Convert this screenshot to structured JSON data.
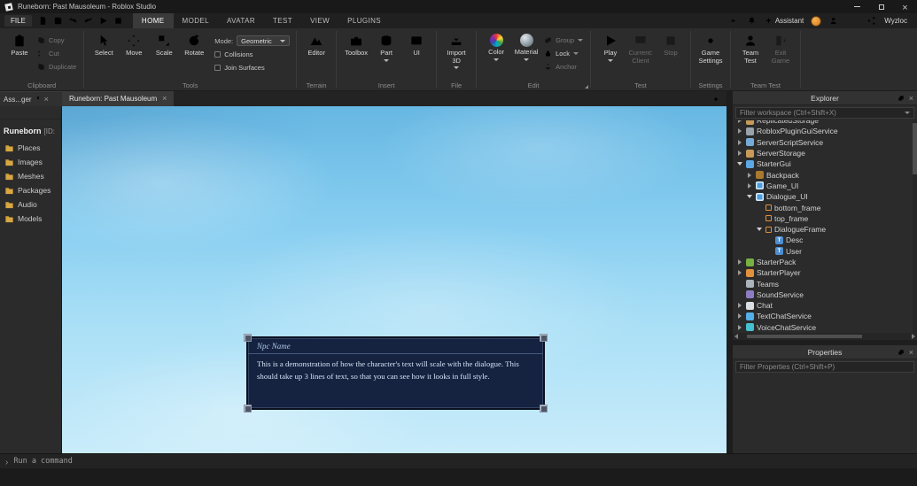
{
  "window": {
    "title": "Runeborn: Past Mausoleum - Roblox Studio"
  },
  "menubar": {
    "file_label": "FILE",
    "tabs": [
      {
        "label": "HOME",
        "state": "active"
      },
      {
        "label": "MODEL",
        "state": ""
      },
      {
        "label": "AVATAR",
        "state": ""
      },
      {
        "label": "TEST",
        "state": ""
      },
      {
        "label": "VIEW",
        "state": ""
      },
      {
        "label": "PLUGINS",
        "state": ""
      }
    ],
    "assistant_label": "Assistant",
    "username": "Wyzloc"
  },
  "ribbon": {
    "clipboard": {
      "label": "Clipboard",
      "paste": "Paste",
      "copy": "Copy",
      "cut": "Cut",
      "duplicate": "Duplicate"
    },
    "tools": {
      "label": "Tools",
      "select": "Select",
      "move": "Move",
      "scale": "Scale",
      "rotate": "Rotate",
      "mode_label": "Mode:",
      "mode_value": "Geometric",
      "collisions": "Collisions",
      "join_surfaces": "Join Surfaces"
    },
    "terrain": {
      "label": "Terrain",
      "editor": "Editor"
    },
    "insert": {
      "label": "Insert",
      "toolbox": "Toolbox",
      "part": "Part",
      "ui": "UI"
    },
    "file": {
      "label": "File",
      "import_3d": "Import 3D"
    },
    "edit": {
      "label": "Edit",
      "color": "Color",
      "material": "Material",
      "group": "Group",
      "lock": "Lock",
      "anchor": "Anchor"
    },
    "test": {
      "label": "Test",
      "play": "Play",
      "current_client": "Current: Client",
      "stop": "Stop"
    },
    "settings": {
      "label": "Settings",
      "game_settings": "Game Settings"
    },
    "team_test": {
      "label": "Team Test",
      "team_test": "Team Test",
      "exit_game": "Exit Game"
    }
  },
  "asset_panel": {
    "tab_label": "Ass...ger",
    "game_name": "Runeborn",
    "game_id_text": "[ID:",
    "items": [
      {
        "label": "Places"
      },
      {
        "label": "Images"
      },
      {
        "label": "Meshes"
      },
      {
        "label": "Packages"
      },
      {
        "label": "Audio"
      },
      {
        "label": "Models"
      }
    ]
  },
  "viewport": {
    "tab_label": "Runeborn: Past Mausoleum",
    "dialogue": {
      "npc_name": "Npc Name",
      "body": "This is a demonstration of how the character's text will scale with the dialogue. This should take up 3 lines of text, so that you can see how it looks in full style."
    }
  },
  "explorer": {
    "title": "Explorer",
    "filter_placeholder": "Filter workspace (Ctrl+Shift+X)",
    "tree": [
      {
        "label": "ReplicatedStorage",
        "level": 0,
        "expander": "closed",
        "icon": "box"
      },
      {
        "label": "RobloxPluginGuiService",
        "level": 0,
        "expander": "closed",
        "icon": "service"
      },
      {
        "label": "ServerScriptService",
        "level": 0,
        "expander": "closed",
        "icon": "script"
      },
      {
        "label": "ServerStorage",
        "level": 0,
        "expander": "closed",
        "icon": "box"
      },
      {
        "label": "StarterGui",
        "level": 0,
        "expander": "open",
        "icon": "screen"
      },
      {
        "label": "Backpack",
        "level": 1,
        "expander": "closed",
        "icon": "backpack"
      },
      {
        "label": "Game_UI",
        "level": 1,
        "expander": "closed",
        "icon": "screengui"
      },
      {
        "label": "Dialogue_UI",
        "level": 1,
        "expander": "open",
        "icon": "screengui"
      },
      {
        "label": "bottom_frame",
        "level": 2,
        "expander": "none",
        "icon": "frame"
      },
      {
        "label": "top_frame",
        "level": 2,
        "expander": "none",
        "icon": "frame"
      },
      {
        "label": "DialogueFrame",
        "level": 2,
        "expander": "open",
        "icon": "frame"
      },
      {
        "label": "Desc",
        "level": 3,
        "expander": "none",
        "icon": "textlabel"
      },
      {
        "label": "User",
        "level": 3,
        "expander": "none",
        "icon": "textlabel"
      },
      {
        "label": "StarterPack",
        "level": 0,
        "expander": "closed",
        "icon": "pack"
      },
      {
        "label": "StarterPlayer",
        "level": 0,
        "expander": "closed",
        "icon": "player"
      },
      {
        "label": "Teams",
        "level": 0,
        "expander": "none",
        "icon": "teams"
      },
      {
        "label": "SoundService",
        "level": 0,
        "expander": "none",
        "icon": "sound"
      },
      {
        "label": "Chat",
        "level": 0,
        "expander": "closed",
        "icon": "chat"
      },
      {
        "label": "TextChatService",
        "level": 0,
        "expander": "closed",
        "icon": "textchat"
      },
      {
        "label": "VoiceChatService",
        "level": 0,
        "expander": "closed",
        "icon": "voice"
      }
    ]
  },
  "properties": {
    "title": "Properties",
    "filter_placeholder": "Filter Properties (Ctrl+Shift+P)"
  },
  "command_bar": {
    "placeholder": "Run a command"
  },
  "colors": {
    "accent_blue": "#1a9af5",
    "sky_top": "#66b7e3",
    "sky_bottom": "#c9ecfa",
    "dialogue_bg": "#152240",
    "folder": "#d9a741"
  }
}
